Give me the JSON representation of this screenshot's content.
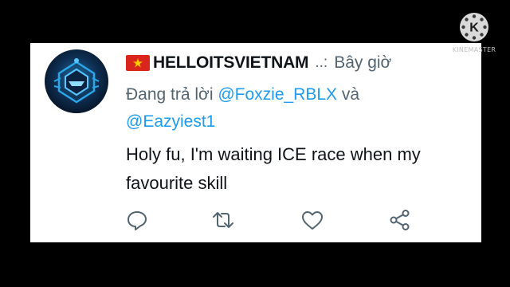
{
  "tweet": {
    "display_name": "HELLOITSVIETNAM",
    "truncation": "..:",
    "timestamp": "Bây giờ",
    "reply_prefix": "Đang trả lời ",
    "reply_to_1": "@Foxzie_RBLX",
    "reply_conjunction": " và",
    "reply_to_2": "@Eazyiest1",
    "text": "Holy fu, I'm waiting ICE race when my favourite skill"
  },
  "actions": {
    "icons": [
      "reply-icon",
      "retweet-icon",
      "like-icon",
      "share-icon"
    ]
  },
  "watermark": {
    "letter": "K",
    "text": "KINEMASTER"
  },
  "colors": {
    "background": "#000000",
    "card": "#ffffff",
    "primary_text": "#0f1419",
    "secondary_text": "#536471",
    "link": "#1d9bf0",
    "flag_red": "#da251d",
    "flag_star": "#ffcd00"
  }
}
